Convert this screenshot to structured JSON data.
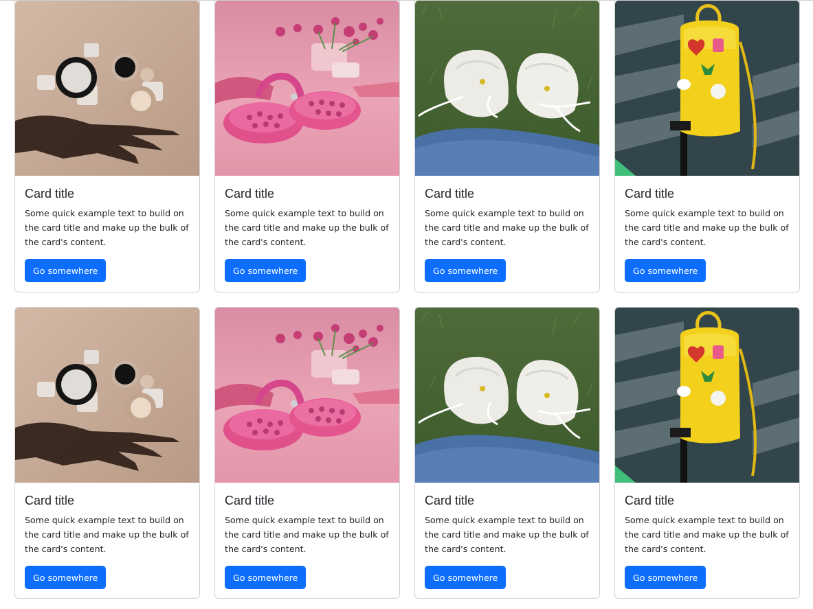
{
  "cards": [
    {
      "image": "cosmetics-hand-shadow-photo",
      "title": "Card title",
      "text": "Some quick example text to build on the card title and make up the bulk of the card's content.",
      "button_label": "Go somewhere"
    },
    {
      "image": "pink-clogs-photo",
      "title": "Card title",
      "text": "Some quick example text to build on the card title and make up the bulk of the card's content.",
      "button_label": "Go somewhere"
    },
    {
      "image": "white-sneakers-jeans-photo",
      "title": "Card title",
      "text": "Some quick example text to build on the card title and make up the bulk of the card's content.",
      "button_label": "Go somewhere"
    },
    {
      "image": "yellow-backpack-stairs-photo",
      "title": "Card title",
      "text": "Some quick example text to build on the card title and make up the bulk of the card's content.",
      "button_label": "Go somewhere"
    },
    {
      "image": "cosmetics-hand-shadow-photo",
      "title": "Card title",
      "text": "Some quick example text to build on the card title and make up the bulk of the card's content.",
      "button_label": "Go somewhere"
    },
    {
      "image": "pink-clogs-photo",
      "title": "Card title",
      "text": "Some quick example text to build on the card title and make up the bulk of the card's content.",
      "button_label": "Go somewhere"
    },
    {
      "image": "white-sneakers-jeans-photo",
      "title": "Card title",
      "text": "Some quick example text to build on the card title and make up the bulk of the card's content.",
      "button_label": "Go somewhere"
    },
    {
      "image": "yellow-backpack-stairs-photo",
      "title": "Card title",
      "text": "Some quick example text to build on the card title and make up the bulk of the card's content.",
      "button_label": "Go somewhere"
    }
  ],
  "colors": {
    "button_bg": "#0d6efd",
    "button_text": "#ffffff",
    "text": "#212529",
    "card_border": "#dcdcdc"
  }
}
